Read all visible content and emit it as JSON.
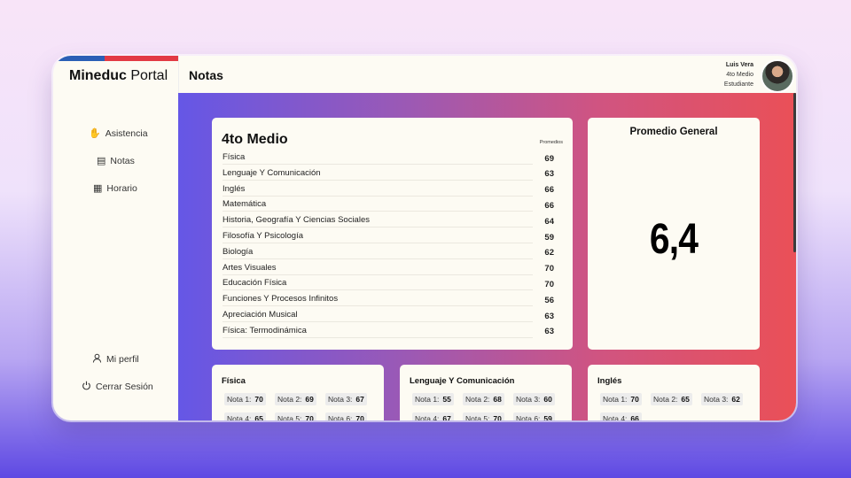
{
  "brand": {
    "bold": "Mineduc",
    "rest": " Portal"
  },
  "sidebar": {
    "items": [
      {
        "label": "Asistencia",
        "icon": "hand-raise-icon"
      },
      {
        "label": "Notas",
        "icon": "notebook-icon"
      },
      {
        "label": "Horario",
        "icon": "calendar-icon"
      }
    ],
    "bottom": [
      {
        "label": "Mi perfil",
        "icon": "user-icon"
      },
      {
        "label": "Cerrar Sesión",
        "icon": "power-icon"
      }
    ]
  },
  "header": {
    "title": "Notas"
  },
  "user": {
    "name": "Luis Vera",
    "grade": "4to Medio",
    "role": "Estudiante"
  },
  "courses_card": {
    "title": "4to Medio",
    "avg_header": "Promedios",
    "rows": [
      {
        "name": "Física",
        "avg": "69"
      },
      {
        "name": "Lenguaje Y Comunicación",
        "avg": "63"
      },
      {
        "name": "Inglés",
        "avg": "66"
      },
      {
        "name": "Matemática",
        "avg": "66"
      },
      {
        "name": "Historia, Geografía Y Ciencias Sociales",
        "avg": "64"
      },
      {
        "name": "Filosofía Y Psicología",
        "avg": "59"
      },
      {
        "name": "Biología",
        "avg": "62"
      },
      {
        "name": "Artes Visuales",
        "avg": "70"
      },
      {
        "name": "Educación Física",
        "avg": "70"
      },
      {
        "name": "Funciones Y Procesos Infinitos",
        "avg": "56"
      },
      {
        "name": "Apreciación Musical",
        "avg": "63"
      },
      {
        "name": "Física: Termodinámica",
        "avg": "63"
      }
    ]
  },
  "general": {
    "title": "Promedio General",
    "value": "6,4"
  },
  "subjects": [
    {
      "title": "Física",
      "grades": [
        {
          "label": "Nota 1:",
          "value": "70"
        },
        {
          "label": "Nota 2:",
          "value": "69"
        },
        {
          "label": "Nota 3:",
          "value": "67"
        },
        {
          "label": "Nota 4:",
          "value": "65"
        },
        {
          "label": "Nota 5:",
          "value": "70"
        },
        {
          "label": "Nota 6:",
          "value": "70"
        }
      ]
    },
    {
      "title": "Lenguaje Y Comunicación",
      "grades": [
        {
          "label": "Nota 1:",
          "value": "55"
        },
        {
          "label": "Nota 2:",
          "value": "68"
        },
        {
          "label": "Nota 3:",
          "value": "60"
        },
        {
          "label": "Nota 4:",
          "value": "67"
        },
        {
          "label": "Nota 5:",
          "value": "70"
        },
        {
          "label": "Nota 6:",
          "value": "59"
        }
      ]
    },
    {
      "title": "Inglés",
      "grades": [
        {
          "label": "Nota 1:",
          "value": "70"
        },
        {
          "label": "Nota 2:",
          "value": "65"
        },
        {
          "label": "Nota 3:",
          "value": "62"
        },
        {
          "label": "Nota 4:",
          "value": "66"
        }
      ]
    }
  ]
}
